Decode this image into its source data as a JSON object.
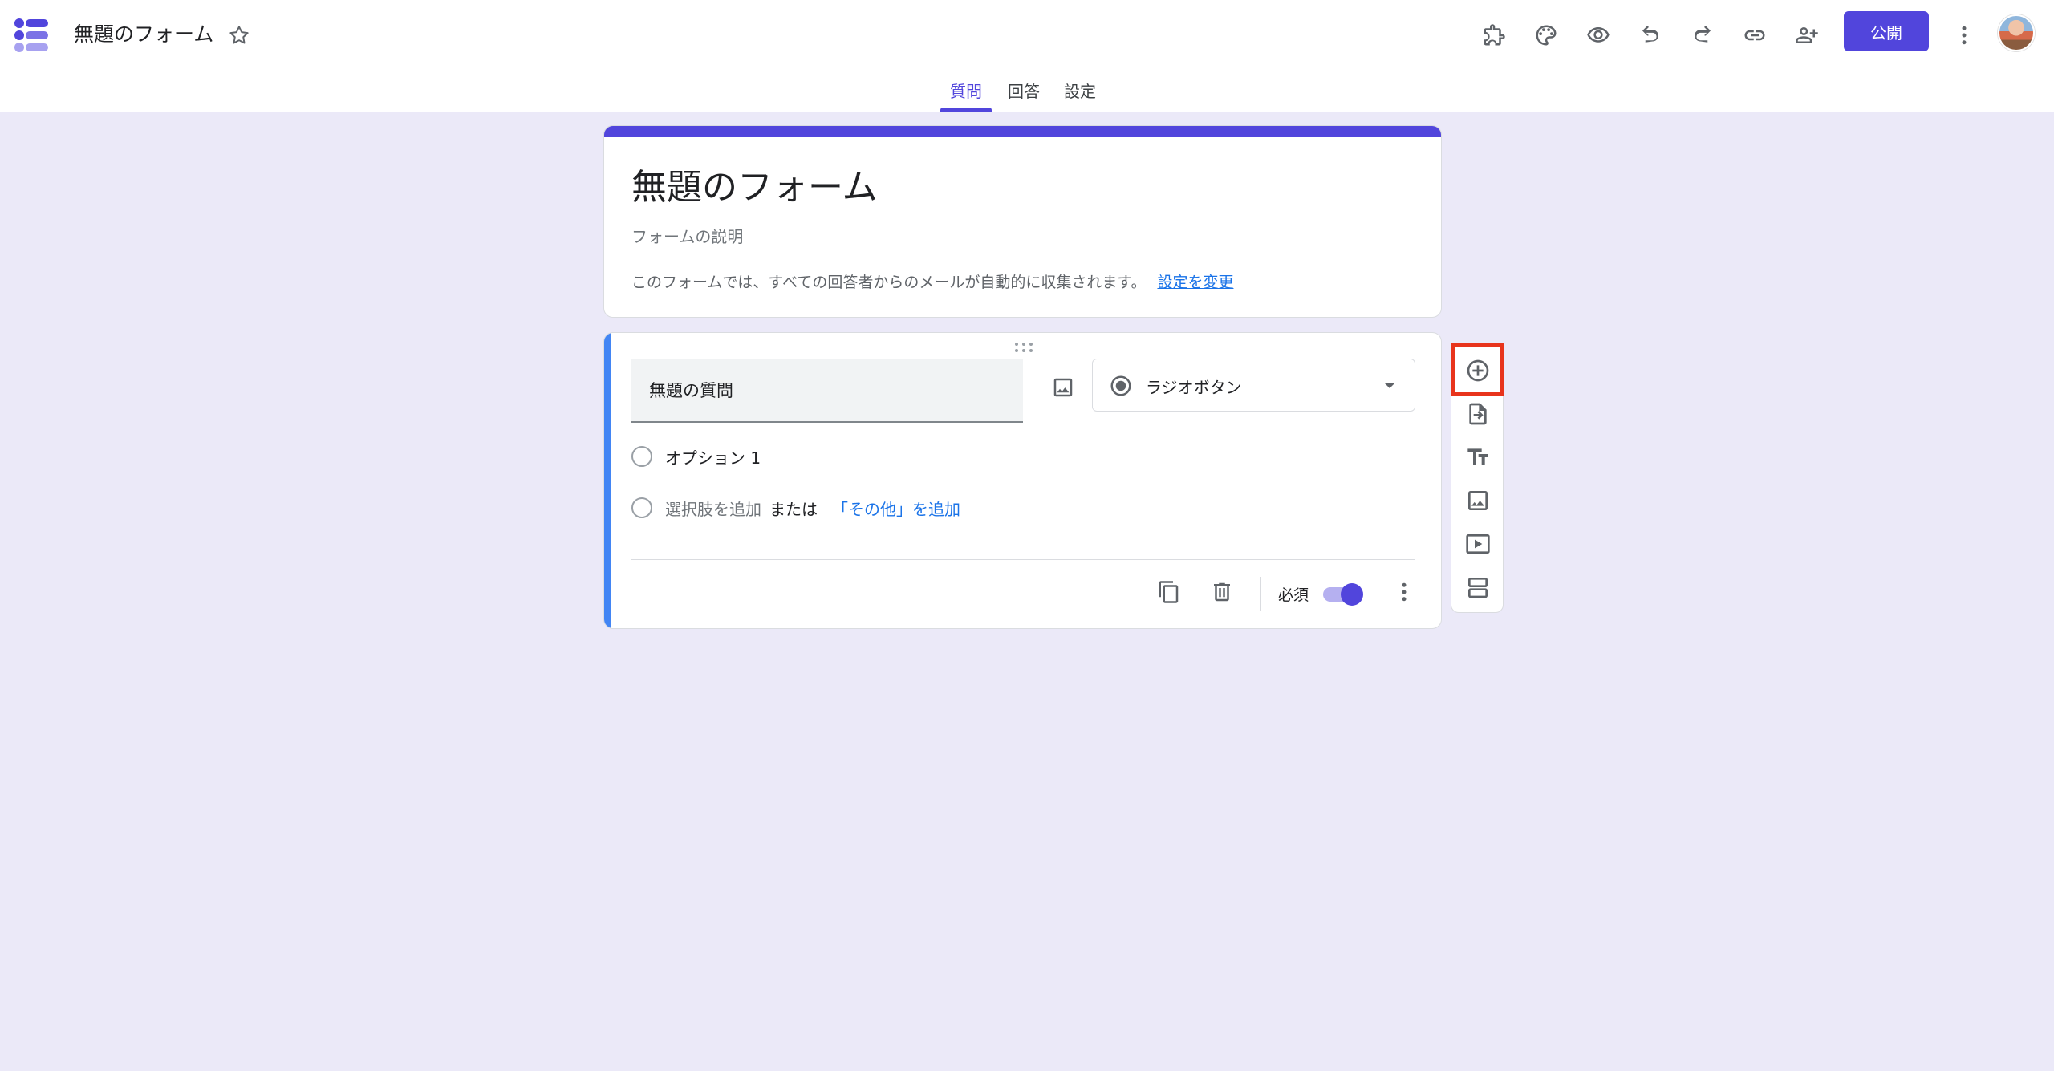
{
  "header": {
    "doc_title": "無題のフォーム",
    "publish_label": "公開"
  },
  "tabs": [
    {
      "label": "質問",
      "active": true
    },
    {
      "label": "回答",
      "active": false
    },
    {
      "label": "設定",
      "active": false
    }
  ],
  "form": {
    "title": "無題のフォーム",
    "description": "フォームの説明",
    "collect_note": "このフォームでは、すべての回答者からのメールが自動的に収集されます。",
    "change_settings_link": "設定を変更"
  },
  "question": {
    "title": "無題の質問",
    "type_label": "ラジオボタン",
    "options": [
      "オプション 1"
    ],
    "add_option_label": "選択肢を追加",
    "or_label": "または",
    "add_other_label": "「その他」を追加",
    "required_label": "必須",
    "required_on": true
  },
  "icons": {
    "toolbar": [
      "puzzle-icon",
      "palette-icon",
      "preview-eye-icon",
      "undo-icon",
      "redo-icon",
      "link-icon",
      "add-collaborator-icon",
      "more-vert-icon"
    ],
    "side_toolbar": [
      "add-question-icon",
      "import-questions-icon",
      "add-title-icon",
      "add-image-icon",
      "add-video-icon",
      "add-section-icon"
    ]
  },
  "colors": {
    "accent": "#5145dc",
    "background": "#ebe9f8",
    "link": "#1a73e8",
    "highlight": "#e8341c"
  }
}
